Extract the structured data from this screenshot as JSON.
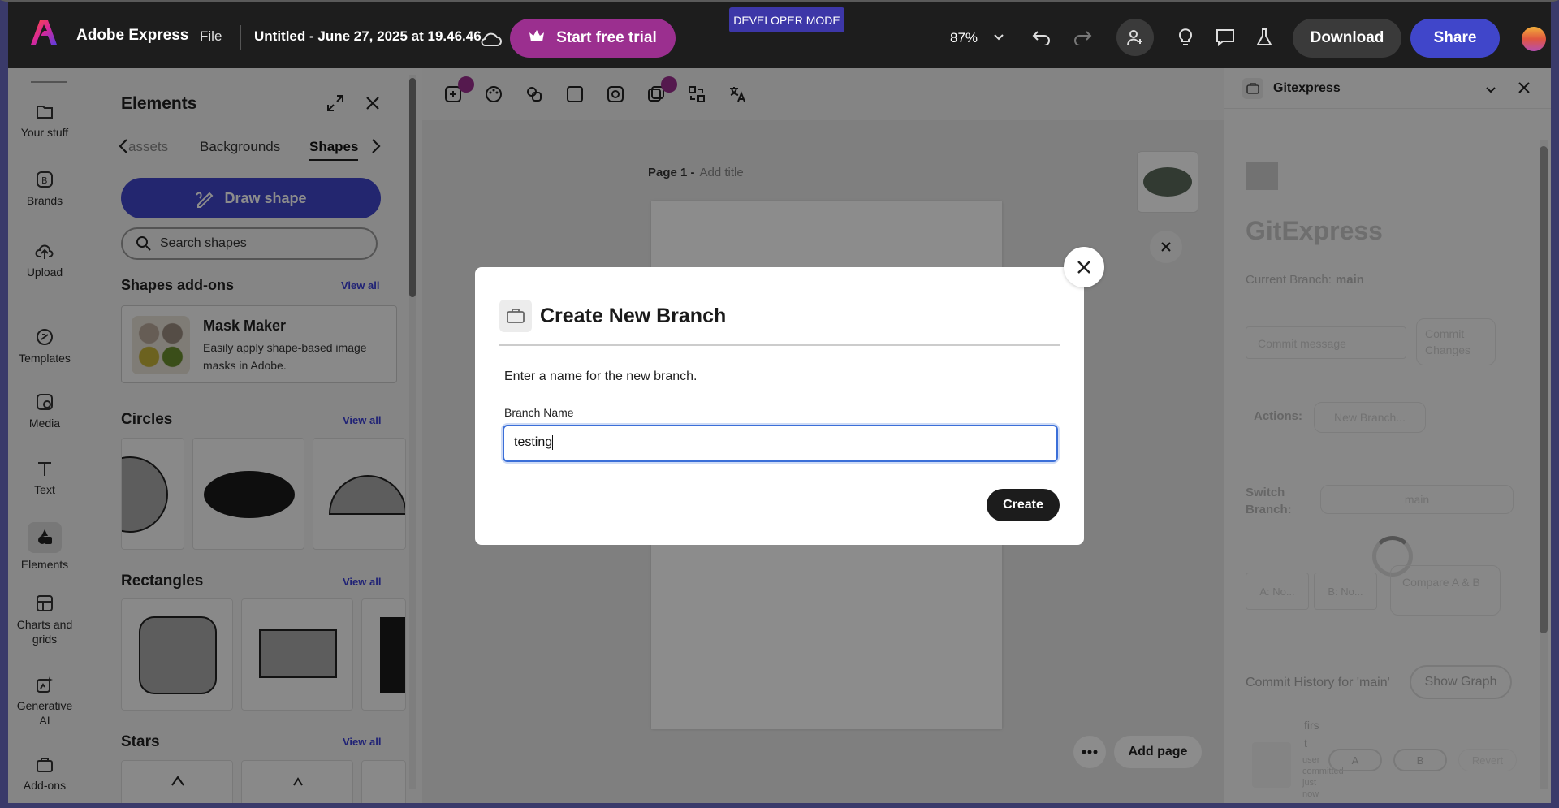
{
  "topbar": {
    "app_name": "Adobe Express",
    "file_menu": "File",
    "doc_title": "Untitled - June 27, 2025 at 19.46.46",
    "trial_label": "Start free trial",
    "dev_mode": "DEVELOPER MODE",
    "zoom": "87%",
    "download_label": "Download",
    "share_label": "Share",
    "brand_color": "#eb1000",
    "accent_color": "#4046ca",
    "trial_color": "#9b2f8f"
  },
  "rail": {
    "items": [
      {
        "label": "Your stuff",
        "icon": "folder-icon"
      },
      {
        "label": "Brands",
        "icon": "brand-icon"
      },
      {
        "label": "Upload",
        "icon": "upload-icon"
      },
      {
        "label": "Templates",
        "icon": "templates-icon"
      },
      {
        "label": "Media",
        "icon": "media-icon"
      },
      {
        "label": "Text",
        "icon": "text-icon"
      },
      {
        "label": "Elements",
        "icon": "elements-icon"
      },
      {
        "label": "Charts and grids",
        "icon": "charts-icon"
      },
      {
        "label": "Generative AI",
        "icon": "generative-ai-icon"
      },
      {
        "label": "Add-ons",
        "icon": "addons-icon"
      }
    ]
  },
  "elements_panel": {
    "title": "Elements",
    "tabs": [
      "assets",
      "Backgrounds",
      "Shapes"
    ],
    "active_tab": "Shapes",
    "draw_shape_label": "Draw shape",
    "search_placeholder": "Search shapes",
    "addons_heading": "Shapes add-ons",
    "view_all": "View all",
    "addon": {
      "name": "Mask Maker",
      "description": "Easily apply shape-based image masks in Adobe."
    },
    "sections": [
      "Circles",
      "Rectangles",
      "Stars"
    ]
  },
  "canvas": {
    "page_label": "Page 1 -",
    "add_title": "Add title",
    "add_page": "Add page"
  },
  "gitexpress": {
    "panel_title": "Gitexpress",
    "logo_text": "GitExpress",
    "current_branch_label": "Current Branch:",
    "current_branch": "main",
    "commit_placeholder": "Commit message",
    "commit_button": "Commit Changes",
    "actions_label": "Actions:",
    "new_branch_button": "New Branch...",
    "switch_label": "Switch Branch:",
    "switch_value": "main",
    "compare_a": "A: No...",
    "compare_b": "B: No...",
    "compare_button": "Compare A & B",
    "history_label": "Commit History for 'main'",
    "show_graph": "Show Graph",
    "commit_message": "first",
    "commit_meta": "user committed just now",
    "btn_a": "A",
    "btn_b": "B",
    "btn_revert": "Revert"
  },
  "modal": {
    "title": "Create New Branch",
    "description": "Enter a name for the new branch.",
    "field_label": "Branch Name",
    "field_value": "testing",
    "create_label": "Create"
  }
}
